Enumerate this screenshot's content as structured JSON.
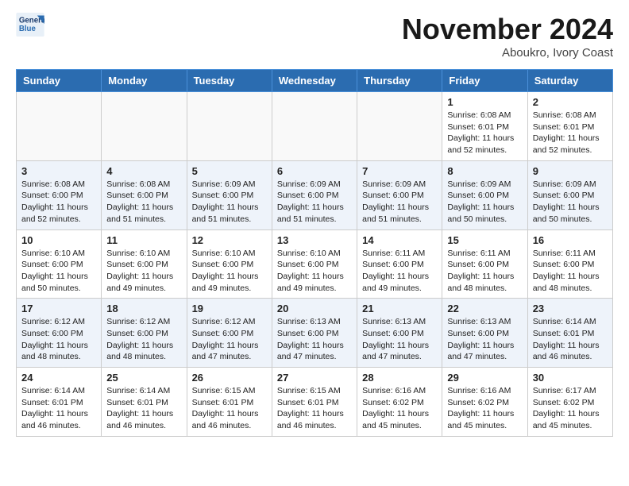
{
  "header": {
    "logo_line1": "General",
    "logo_line2": "Blue",
    "month": "November 2024",
    "location": "Aboukro, Ivory Coast"
  },
  "days_of_week": [
    "Sunday",
    "Monday",
    "Tuesday",
    "Wednesday",
    "Thursday",
    "Friday",
    "Saturday"
  ],
  "weeks": [
    [
      {
        "day": "",
        "empty": true
      },
      {
        "day": "",
        "empty": true
      },
      {
        "day": "",
        "empty": true
      },
      {
        "day": "",
        "empty": true
      },
      {
        "day": "",
        "empty": true
      },
      {
        "day": "1",
        "sunrise": "6:08 AM",
        "sunset": "6:01 PM",
        "daylight": "11 hours and 52 minutes."
      },
      {
        "day": "2",
        "sunrise": "6:08 AM",
        "sunset": "6:01 PM",
        "daylight": "11 hours and 52 minutes."
      }
    ],
    [
      {
        "day": "3",
        "sunrise": "6:08 AM",
        "sunset": "6:00 PM",
        "daylight": "11 hours and 52 minutes."
      },
      {
        "day": "4",
        "sunrise": "6:08 AM",
        "sunset": "6:00 PM",
        "daylight": "11 hours and 51 minutes."
      },
      {
        "day": "5",
        "sunrise": "6:09 AM",
        "sunset": "6:00 PM",
        "daylight": "11 hours and 51 minutes."
      },
      {
        "day": "6",
        "sunrise": "6:09 AM",
        "sunset": "6:00 PM",
        "daylight": "11 hours and 51 minutes."
      },
      {
        "day": "7",
        "sunrise": "6:09 AM",
        "sunset": "6:00 PM",
        "daylight": "11 hours and 51 minutes."
      },
      {
        "day": "8",
        "sunrise": "6:09 AM",
        "sunset": "6:00 PM",
        "daylight": "11 hours and 50 minutes."
      },
      {
        "day": "9",
        "sunrise": "6:09 AM",
        "sunset": "6:00 PM",
        "daylight": "11 hours and 50 minutes."
      }
    ],
    [
      {
        "day": "10",
        "sunrise": "6:10 AM",
        "sunset": "6:00 PM",
        "daylight": "11 hours and 50 minutes."
      },
      {
        "day": "11",
        "sunrise": "6:10 AM",
        "sunset": "6:00 PM",
        "daylight": "11 hours and 49 minutes."
      },
      {
        "day": "12",
        "sunrise": "6:10 AM",
        "sunset": "6:00 PM",
        "daylight": "11 hours and 49 minutes."
      },
      {
        "day": "13",
        "sunrise": "6:10 AM",
        "sunset": "6:00 PM",
        "daylight": "11 hours and 49 minutes."
      },
      {
        "day": "14",
        "sunrise": "6:11 AM",
        "sunset": "6:00 PM",
        "daylight": "11 hours and 49 minutes."
      },
      {
        "day": "15",
        "sunrise": "6:11 AM",
        "sunset": "6:00 PM",
        "daylight": "11 hours and 48 minutes."
      },
      {
        "day": "16",
        "sunrise": "6:11 AM",
        "sunset": "6:00 PM",
        "daylight": "11 hours and 48 minutes."
      }
    ],
    [
      {
        "day": "17",
        "sunrise": "6:12 AM",
        "sunset": "6:00 PM",
        "daylight": "11 hours and 48 minutes."
      },
      {
        "day": "18",
        "sunrise": "6:12 AM",
        "sunset": "6:00 PM",
        "daylight": "11 hours and 48 minutes."
      },
      {
        "day": "19",
        "sunrise": "6:12 AM",
        "sunset": "6:00 PM",
        "daylight": "11 hours and 47 minutes."
      },
      {
        "day": "20",
        "sunrise": "6:13 AM",
        "sunset": "6:00 PM",
        "daylight": "11 hours and 47 minutes."
      },
      {
        "day": "21",
        "sunrise": "6:13 AM",
        "sunset": "6:00 PM",
        "daylight": "11 hours and 47 minutes."
      },
      {
        "day": "22",
        "sunrise": "6:13 AM",
        "sunset": "6:00 PM",
        "daylight": "11 hours and 47 minutes."
      },
      {
        "day": "23",
        "sunrise": "6:14 AM",
        "sunset": "6:01 PM",
        "daylight": "11 hours and 46 minutes."
      }
    ],
    [
      {
        "day": "24",
        "sunrise": "6:14 AM",
        "sunset": "6:01 PM",
        "daylight": "11 hours and 46 minutes."
      },
      {
        "day": "25",
        "sunrise": "6:14 AM",
        "sunset": "6:01 PM",
        "daylight": "11 hours and 46 minutes."
      },
      {
        "day": "26",
        "sunrise": "6:15 AM",
        "sunset": "6:01 PM",
        "daylight": "11 hours and 46 minutes."
      },
      {
        "day": "27",
        "sunrise": "6:15 AM",
        "sunset": "6:01 PM",
        "daylight": "11 hours and 46 minutes."
      },
      {
        "day": "28",
        "sunrise": "6:16 AM",
        "sunset": "6:02 PM",
        "daylight": "11 hours and 45 minutes."
      },
      {
        "day": "29",
        "sunrise": "6:16 AM",
        "sunset": "6:02 PM",
        "daylight": "11 hours and 45 minutes."
      },
      {
        "day": "30",
        "sunrise": "6:17 AM",
        "sunset": "6:02 PM",
        "daylight": "11 hours and 45 minutes."
      }
    ]
  ]
}
